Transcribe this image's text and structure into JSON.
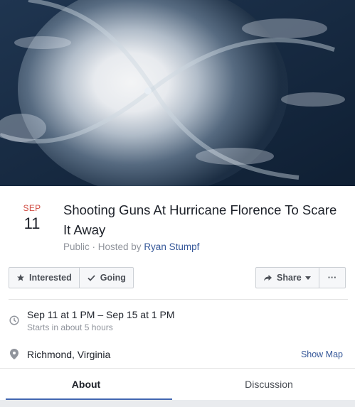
{
  "cover": {
    "alt_icon": "hurricane-satellite-image"
  },
  "event": {
    "month": "SEP",
    "day": "11",
    "title": "Shooting Guns At Hurricane Florence To Scare It Away",
    "privacy": "Public",
    "hosted_prefix": " · Hosted by ",
    "host": "Ryan Stumpf"
  },
  "actions": {
    "interested": "Interested",
    "going": "Going",
    "share": "Share",
    "more": "···"
  },
  "details": {
    "when": "Sep 11 at 1 PM – Sep 15 at 1 PM",
    "when_sub": "Starts in about 5 hours",
    "location": "Richmond, Virginia",
    "show_map": "Show Map"
  },
  "tabs": [
    {
      "label": "About",
      "active": true
    },
    {
      "label": "Discussion",
      "active": false
    }
  ],
  "colors": {
    "accent": "#4267b2",
    "month": "#d0493f",
    "link": "#365899"
  }
}
